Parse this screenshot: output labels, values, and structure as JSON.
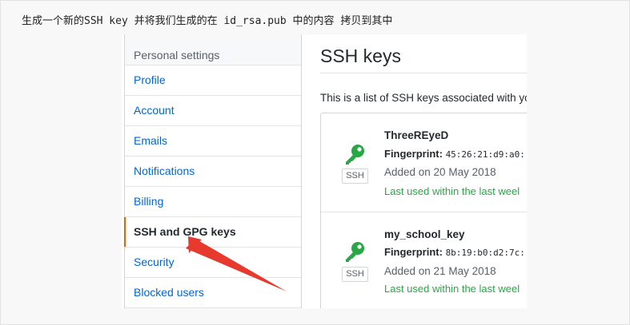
{
  "caption": "生成一个新的SSH key 并将我们生成的在 id_rsa.pub 中的内容 拷贝到其中",
  "sidebar": {
    "header": "Personal settings",
    "items": [
      {
        "label": "Profile"
      },
      {
        "label": "Account"
      },
      {
        "label": "Emails"
      },
      {
        "label": "Notifications"
      },
      {
        "label": "Billing"
      },
      {
        "label": "SSH and GPG keys"
      },
      {
        "label": "Security"
      },
      {
        "label": "Blocked users"
      }
    ],
    "selected_index": 5
  },
  "main": {
    "title": "SSH keys",
    "description": "This is a list of SSH keys associated with yc",
    "keys": [
      {
        "name": "ThreeREyeD",
        "fingerprint_label": "Fingerprint:",
        "fingerprint": "45:26:21:d9:a0:",
        "added": "Added on 20 May 2018",
        "last_used": "Last used within the last weel",
        "badge": "SSH",
        "icon": "key-icon"
      },
      {
        "name": "my_school_key",
        "fingerprint_label": "Fingerprint:",
        "fingerprint": "8b:19:b0:d2:7c:",
        "added": "Added on 21 May 2018",
        "last_used": "Last used within the last weel",
        "badge": "SSH",
        "icon": "key-icon"
      }
    ]
  },
  "colors": {
    "link": "#0366d6",
    "selected_bar": "#e36209",
    "key_green": "#28a745",
    "annotation_arrow": "#e8392f"
  }
}
